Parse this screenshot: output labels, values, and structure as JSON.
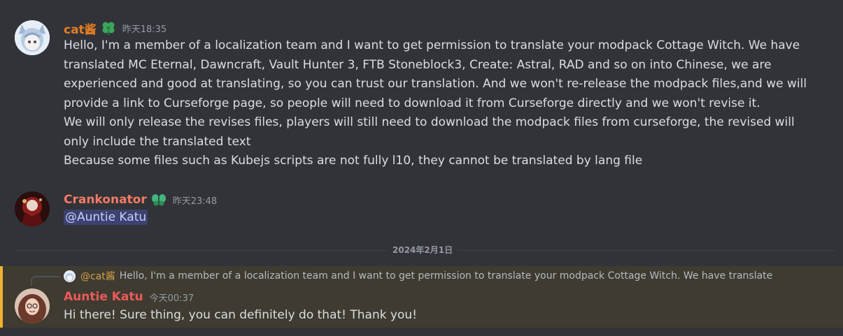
{
  "messages": [
    {
      "username": "cat酱",
      "username_color": "#e67e22",
      "role_icon": "leaf-icon",
      "timestamp": "昨天18:35",
      "lines": [
        "Hello, I'm a member of a localization team and I want to get permission to translate your modpack Cottage Witch. We have",
        "translated MC Eternal, Dawncraft, Vault Hunter 3, FTB Stoneblock3, Create: Astral, RAD and so on into Chinese, we are",
        "experienced and good at translating, so you can trust our translation. And we won't re-release the modpack files,and we will",
        "provide a link to Curseforge page, so people will need to download it from Curseforge directly and we won't revise it.",
        "We will only release the revises files, players will still need to download the modpack files from curseforge, the revised will",
        "only include the translated text",
        "Because some files such as Kubejs scripts are not fully l10, they cannot be translated by lang file"
      ]
    },
    {
      "username": "Crankonator",
      "username_color": "#f47b67",
      "role_icon": "moth-icon",
      "timestamp": "昨天23:48",
      "mention": "@Auntie Katu"
    },
    {
      "username": "Auntie Katu",
      "username_color": "#ed5a5a",
      "timestamp": "今天00:37",
      "reply_to_name": "@cat酱",
      "reply_preview": "Hello, I'm a member of a localization team and I want to get permission to translate your modpack Cottage Witch. We have translate",
      "text": "Hi there! Sure thing, you can definitely do that! Thank you!"
    }
  ],
  "date_divider": "2024年2月1日",
  "colors": {
    "background": "#313338",
    "highlight_background": "#3f3b31",
    "highlight_border": "#f0b232",
    "mention_background": "#3c4270"
  }
}
